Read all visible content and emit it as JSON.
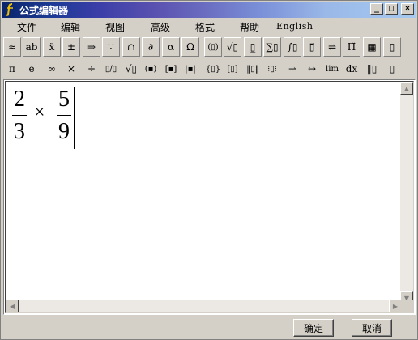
{
  "window": {
    "title": "公式编辑器"
  },
  "title_buttons": {
    "minimize": "_",
    "maximize": "□",
    "close": "×"
  },
  "menu": [
    "文件",
    "编辑",
    "视图",
    "高级",
    "格式",
    "帮助",
    "English"
  ],
  "toolbar1": [
    {
      "name": "relations-palette",
      "glyph": "≈"
    },
    {
      "name": "spaces-palette",
      "glyph": "ab"
    },
    {
      "name": "embellishments-palette",
      "glyph": "ẍ"
    },
    {
      "name": "operators-palette",
      "glyph": "±"
    },
    {
      "name": "arrows-palette",
      "glyph": "⇒"
    },
    {
      "name": "logic-palette",
      "glyph": "∵"
    },
    {
      "name": "sets-palette",
      "glyph": "∩"
    },
    {
      "name": "misc-symbols-palette",
      "glyph": "∂"
    },
    {
      "name": "greek-lower-palette",
      "glyph": "α"
    },
    {
      "name": "greek-upper-palette",
      "glyph": "Ω"
    },
    {
      "name": "fences-palette",
      "glyph": "(▯)"
    },
    {
      "name": "fractions-radicals-palette",
      "glyph": "√▯"
    },
    {
      "name": "subscript-palette",
      "glyph": "▯̲"
    },
    {
      "name": "summation-palette",
      "glyph": "∑▯"
    },
    {
      "name": "integral-palette",
      "glyph": "∫▯"
    },
    {
      "name": "overbar-palette",
      "glyph": "▯⃗"
    },
    {
      "name": "labeled-arrows-palette",
      "glyph": "⇌"
    },
    {
      "name": "products-palette",
      "glyph": "Π̈"
    },
    {
      "name": "matrix-palette",
      "glyph": "▦"
    },
    {
      "name": "templates-palette",
      "glyph": "▯"
    }
  ],
  "toolbar2": [
    {
      "name": "pi-symbol",
      "glyph": "π"
    },
    {
      "name": "e-symbol",
      "glyph": "e"
    },
    {
      "name": "infinity-symbol",
      "glyph": "∞"
    },
    {
      "name": "times-symbol",
      "glyph": "×"
    },
    {
      "name": "divide-symbol",
      "glyph": "÷"
    },
    {
      "name": "fraction-template",
      "glyph": "▯/▯"
    },
    {
      "name": "sqrt-template",
      "glyph": "√▯"
    },
    {
      "name": "paren-template",
      "glyph": "(▪)"
    },
    {
      "name": "bracket-template",
      "glyph": "[▪]"
    },
    {
      "name": "abs-template",
      "glyph": "|▪|"
    },
    {
      "name": "brace-template",
      "glyph": "{▯}"
    },
    {
      "name": "square-bracket-template",
      "glyph": "[▯]"
    },
    {
      "name": "norm-template",
      "glyph": "‖▯‖"
    },
    {
      "name": "box-template",
      "glyph": "⁝▯⁝"
    },
    {
      "name": "right-arrow-template",
      "glyph": "⇀"
    },
    {
      "name": "left-right-arrow-template",
      "glyph": "↔"
    },
    {
      "name": "limit-template",
      "glyph": "lim"
    },
    {
      "name": "dx-template",
      "glyph": "dx"
    },
    {
      "name": "matrix-2x1-template",
      "glyph": "‖▯"
    },
    {
      "name": "matrix-col-template",
      "glyph": "▯"
    }
  ],
  "formula": {
    "frac1_num": "2",
    "frac1_den": "3",
    "operator": "×",
    "frac2_num": "5",
    "frac2_den": "9"
  },
  "buttons": {
    "ok": "确定",
    "cancel": "取消"
  },
  "colors": {
    "title_start": "#0a246a",
    "title_end": "#a6caf0",
    "chrome": "#d4d0c8"
  }
}
